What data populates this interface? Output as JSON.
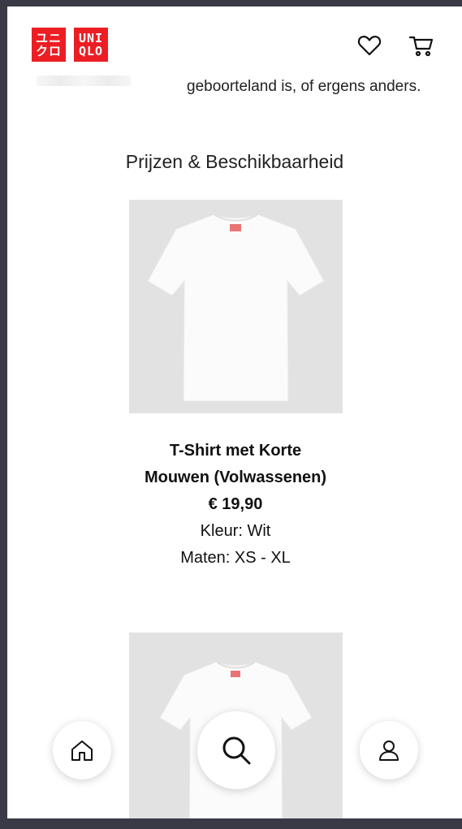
{
  "header": {
    "logo_katakana": [
      "ユニ",
      "クロ"
    ],
    "logo_latin": [
      "UNI",
      "QLO"
    ],
    "brand_color": "#ed1d24",
    "icons": [
      "heart-icon",
      "cart-icon"
    ]
  },
  "intro": {
    "text": "geboorteland is, of ergens anders."
  },
  "section": {
    "title": "Prijzen & Beschikbaarheid"
  },
  "products": [
    {
      "name_line1": "T-Shirt met Korte",
      "name_line2": "Mouwen (Volwassenen)",
      "price": "€ 19,90",
      "color": "Kleur: Wit",
      "sizes": "Maten: XS - XL"
    }
  ],
  "bottom_nav": {
    "icons": [
      "home-icon",
      "search-icon",
      "user-icon"
    ]
  }
}
